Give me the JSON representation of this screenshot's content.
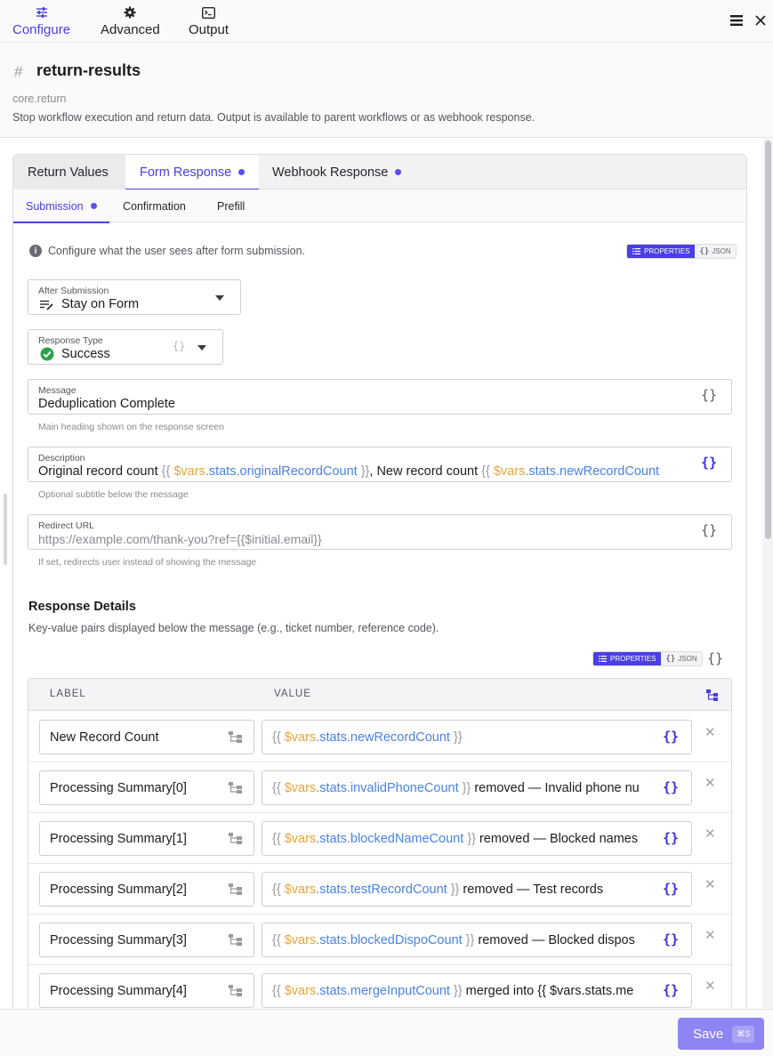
{
  "top_tabs": [
    {
      "label": "Configure",
      "icon": "sliders-icon",
      "active": true
    },
    {
      "label": "Advanced",
      "icon": "gear-icon",
      "active": false
    },
    {
      "label": "Output",
      "icon": "terminal-icon",
      "active": false
    }
  ],
  "node": {
    "title": "return-results",
    "type": "core.return",
    "description": "Stop workflow execution and return data. Output is available to parent workflows or as webhook response."
  },
  "section_tabs": [
    {
      "label": "Return Values",
      "active": false,
      "dot": false
    },
    {
      "label": "Form Response",
      "active": true,
      "dot": true
    },
    {
      "label": "Webhook Response",
      "active": false,
      "dot": true
    }
  ],
  "sub_tabs": [
    {
      "label": "Submission",
      "active": true,
      "dot": true
    },
    {
      "label": "Confirmation",
      "active": false,
      "dot": false
    },
    {
      "label": "Prefill",
      "active": false,
      "dot": false
    }
  ],
  "info_text": "Configure what the user sees after form submission.",
  "view_toggle": {
    "properties": "PROPERTIES",
    "json": "JSON"
  },
  "after_submission": {
    "label": "After Submission",
    "value": "Stay on Form"
  },
  "response_type": {
    "label": "Response Type",
    "value": "Success"
  },
  "message": {
    "label": "Message",
    "value": "Deduplication Complete",
    "hint": "Main heading shown on the response screen"
  },
  "description": {
    "label": "Description",
    "parts": [
      "Original record count ",
      "{{ ",
      "$vars",
      ".stats.",
      "originalRecordCount",
      " }}",
      ", New record count ",
      "{{ ",
      "$vars",
      ".stats.",
      "newRecordCount"
    ],
    "hint": "Optional subtitle below the message"
  },
  "redirect": {
    "label": "Redirect URL",
    "placeholder": "https://example.com/thank-you?ref={{$initial.email}}",
    "hint": "If set, redirects user instead of showing the message"
  },
  "details": {
    "title": "Response Details",
    "description": "Key-value pairs displayed below the message (e.g., ticket number, reference code).",
    "col_label": "LABEL",
    "col_value": "VALUE",
    "rows": [
      {
        "label": "New Record Count",
        "open": "{{ ",
        "var": "$vars",
        "mid": ".stats.",
        "prop": "newRecordCount",
        "close": " }}",
        "rest": ""
      },
      {
        "label": "Processing Summary[0]",
        "open": "{{ ",
        "var": "$vars",
        "mid": ".stats.",
        "prop": "invalidPhoneCount",
        "close": " }}",
        "rest": " removed — Invalid phone nu"
      },
      {
        "label": "Processing Summary[1]",
        "open": "{{ ",
        "var": "$vars",
        "mid": ".stats.",
        "prop": "blockedNameCount",
        "close": " }}",
        "rest": " removed — Blocked names"
      },
      {
        "label": "Processing Summary[2]",
        "open": "{{ ",
        "var": "$vars",
        "mid": ".stats.",
        "prop": "testRecordCount",
        "close": " }}",
        "rest": " removed — Test records"
      },
      {
        "label": "Processing Summary[3]",
        "open": "{{ ",
        "var": "$vars",
        "mid": ".stats.",
        "prop": "blockedDispoCount",
        "close": " }}",
        "rest": " removed — Blocked dispos"
      },
      {
        "label": "Processing Summary[4]",
        "open": "{{ ",
        "var": "$vars",
        "mid": ".stats.",
        "prop": "mergeInputCount",
        "close": " }}",
        "rest": " merged into {{ $vars.stats.me"
      }
    ]
  },
  "footer": {
    "save_label": "Save",
    "shortcut": "⌘S"
  },
  "colors": {
    "accent": "#4a3ee6",
    "variable": "#e8a33a",
    "property": "#4a82e8",
    "success": "#2fa14b"
  }
}
